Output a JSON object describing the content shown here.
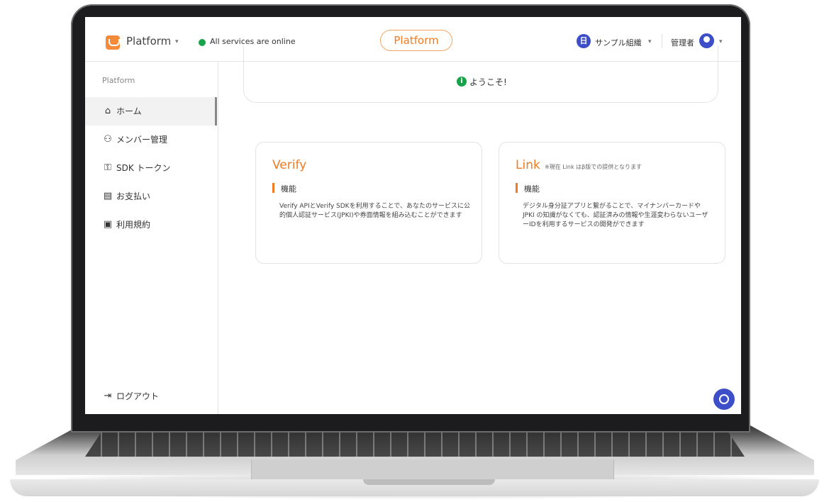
{
  "header": {
    "app_name": "Platform",
    "status_text": "All services are online",
    "environment": "Platform",
    "org_icon": "日",
    "org_name": "サンプル組織",
    "role": "管理者",
    "caret": "▾",
    "colors": {
      "accent": "#f07b23",
      "status_ok": "#16a34a",
      "brand_blue": "#3d4fc8"
    }
  },
  "sidebar": {
    "heading": "Platform",
    "items": [
      {
        "label": "ホーム",
        "icon": "home-icon",
        "glyph": "⌂",
        "active": true
      },
      {
        "label": "メンバー管理",
        "icon": "users-icon",
        "glyph": "⚇"
      },
      {
        "label": "SDK トークン",
        "icon": "key-icon",
        "glyph": "⚿"
      },
      {
        "label": "お支払い",
        "icon": "billing-icon",
        "glyph": "▤"
      },
      {
        "label": "利用規約",
        "icon": "terms-icon",
        "glyph": "▣"
      }
    ],
    "logout": {
      "label": "ログアウト",
      "icon": "logout-icon",
      "glyph": "⇥"
    }
  },
  "main": {
    "welcome": {
      "icon": "info-icon",
      "glyph": "i",
      "text": "ようこそ!"
    },
    "cards": [
      {
        "title": "Verify",
        "note": "",
        "subheading": "機能",
        "body": "Verify APIとVerify SDKを利用することで、あなたのサービスに公的個人認証サービス(JPKI)や券面情報を組み込むことができます"
      },
      {
        "title": "Link",
        "note": "※現在 Link はβ版での提供となります",
        "subheading": "機能",
        "body": "デジタル身分証アプリと繋がることで、マイナンバーカードや JPKI の知識がなくても、認証済みの情報や生涯変わらないユーザーIDを利用するサービスの開発ができます"
      }
    ]
  },
  "chat": {
    "icon": "chat-icon"
  }
}
